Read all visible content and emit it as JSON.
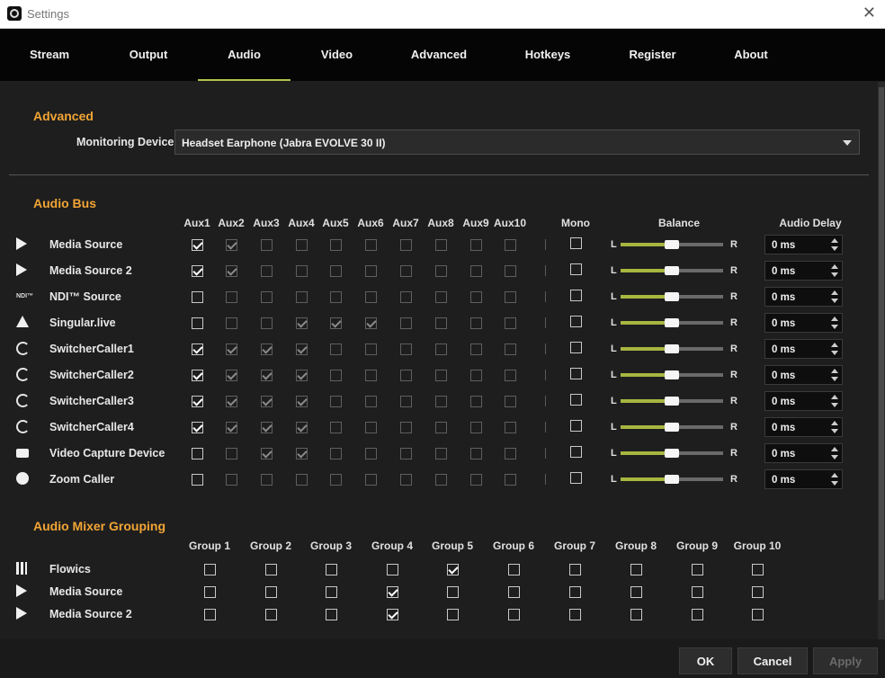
{
  "window": {
    "title": "Settings",
    "close_glyph": "✕"
  },
  "tabs": [
    {
      "label": "Stream",
      "active": false
    },
    {
      "label": "Output",
      "active": false
    },
    {
      "label": "Audio",
      "active": true
    },
    {
      "label": "Video",
      "active": false
    },
    {
      "label": "Advanced",
      "active": false
    },
    {
      "label": "Hotkeys",
      "active": false
    },
    {
      "label": "Register",
      "active": false
    },
    {
      "label": "About",
      "active": false
    }
  ],
  "advanced": {
    "title": "Advanced",
    "monitoring_label": "Monitoring Device",
    "monitoring_value": "Headset Earphone (Jabra EVOLVE 30 II)"
  },
  "audio_bus": {
    "title": "Audio Bus",
    "aux_headers": [
      "Aux1",
      "Aux2",
      "Aux3",
      "Aux4",
      "Aux5",
      "Aux6",
      "Aux7",
      "Aux8",
      "Aux9",
      "Aux10"
    ],
    "mono_header": "Mono",
    "balance_header": "Balance",
    "delay_header": "Audio Delay",
    "left_label": "L",
    "right_label": "R",
    "rows": [
      {
        "name": "Media Source",
        "icon": "play-icon",
        "aux": [
          1,
          1,
          0,
          0,
          0,
          0,
          0,
          0,
          0,
          0
        ],
        "mono": false,
        "balance": 0.5,
        "delay": "0 ms"
      },
      {
        "name": "Media Source 2",
        "icon": "play-icon",
        "aux": [
          1,
          1,
          0,
          0,
          0,
          0,
          0,
          0,
          0,
          0
        ],
        "mono": false,
        "balance": 0.5,
        "delay": "0 ms"
      },
      {
        "name": "NDI™ Source",
        "icon": "ndi-icon",
        "aux": [
          0,
          0,
          0,
          0,
          0,
          0,
          0,
          0,
          0,
          0
        ],
        "mono": false,
        "balance": 0.5,
        "delay": "0 ms"
      },
      {
        "name": "Singular.live",
        "icon": "singular-icon",
        "aux": [
          0,
          0,
          0,
          1,
          1,
          1,
          0,
          0,
          0,
          0
        ],
        "mono": false,
        "balance": 0.5,
        "delay": "0 ms"
      },
      {
        "name": "SwitcherCaller1",
        "icon": "switchercaller-icon",
        "aux": [
          1,
          1,
          1,
          1,
          0,
          0,
          0,
          0,
          0,
          0
        ],
        "mono": false,
        "balance": 0.5,
        "delay": "0 ms"
      },
      {
        "name": "SwitcherCaller2",
        "icon": "switchercaller-icon",
        "aux": [
          1,
          1,
          1,
          1,
          0,
          0,
          0,
          0,
          0,
          0
        ],
        "mono": false,
        "balance": 0.5,
        "delay": "0 ms"
      },
      {
        "name": "SwitcherCaller3",
        "icon": "switchercaller-icon",
        "aux": [
          1,
          1,
          1,
          1,
          0,
          0,
          0,
          0,
          0,
          0
        ],
        "mono": false,
        "balance": 0.5,
        "delay": "0 ms"
      },
      {
        "name": "SwitcherCaller4",
        "icon": "switchercaller-icon",
        "aux": [
          1,
          1,
          1,
          1,
          0,
          0,
          0,
          0,
          0,
          0
        ],
        "mono": false,
        "balance": 0.5,
        "delay": "0 ms"
      },
      {
        "name": "Video Capture Device",
        "icon": "camera-icon",
        "aux": [
          0,
          0,
          1,
          1,
          0,
          0,
          0,
          0,
          0,
          0
        ],
        "mono": false,
        "balance": 0.5,
        "delay": "0 ms"
      },
      {
        "name": "Zoom Caller",
        "icon": "zoom-icon",
        "aux": [
          0,
          0,
          0,
          0,
          0,
          0,
          0,
          0,
          0,
          0
        ],
        "mono": false,
        "balance": 0.5,
        "delay": "0 ms"
      }
    ]
  },
  "mixer_grouping": {
    "title": "Audio Mixer Grouping",
    "group_headers": [
      "Group 1",
      "Group 2",
      "Group 3",
      "Group 4",
      "Group 5",
      "Group 6",
      "Group 7",
      "Group 8",
      "Group 9",
      "Group 10"
    ],
    "rows": [
      {
        "name": "Flowics",
        "icon": "flowics-icon",
        "groups": [
          0,
          0,
          0,
          0,
          1,
          0,
          0,
          0,
          0,
          0
        ]
      },
      {
        "name": "Media Source",
        "icon": "play-icon",
        "groups": [
          0,
          0,
          0,
          1,
          0,
          0,
          0,
          0,
          0,
          0
        ]
      },
      {
        "name": "Media Source 2",
        "icon": "play-icon",
        "groups": [
          0,
          0,
          0,
          1,
          0,
          0,
          0,
          0,
          0,
          0
        ]
      }
    ]
  },
  "buttons": {
    "ok": "OK",
    "cancel": "Cancel",
    "apply": "Apply"
  },
  "colors": {
    "accent": "#f2a535",
    "slider": "#a8b640",
    "tab_underline": "#b4c24b"
  }
}
